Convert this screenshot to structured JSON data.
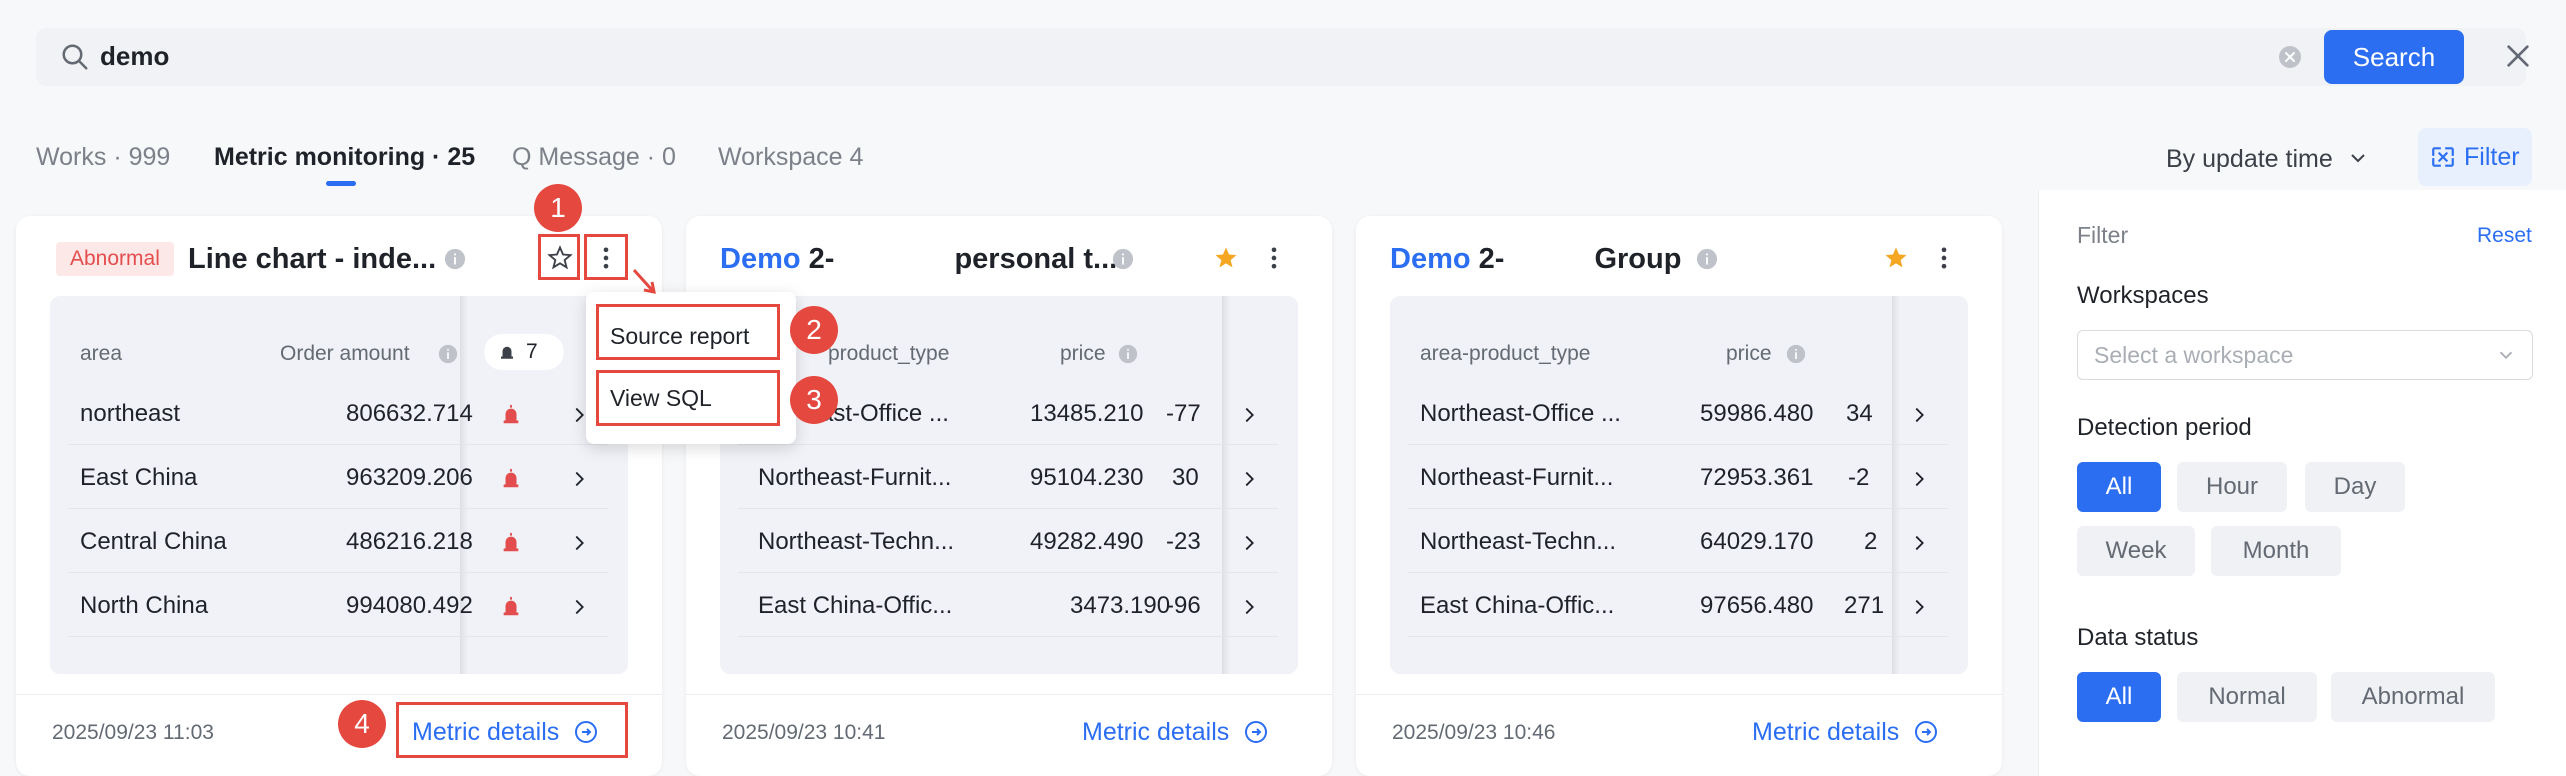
{
  "search": {
    "value": "demo",
    "button_label": "Search"
  },
  "tabs": [
    {
      "label": "Works · 999"
    },
    {
      "label": "Metric monitoring · 25"
    },
    {
      "label": "Q Message · 0"
    },
    {
      "label": "Workspace 4"
    }
  ],
  "sort_label": "By update time",
  "filter_button_label": "Filter",
  "cards": [
    {
      "badge": "Abnormal",
      "title": "Line chart - inde...",
      "headers": [
        "area",
        "Order amount",
        "7"
      ],
      "rows": [
        {
          "name": "northeast",
          "value": "806632.714"
        },
        {
          "name": "East China",
          "value": "963209.206"
        },
        {
          "name": "Central China",
          "value": "486216.218"
        },
        {
          "name": "North China",
          "value": "994080.492"
        }
      ],
      "date": "2025/09/23 11:03",
      "details_label": "Metric details"
    },
    {
      "title_prefix": "Demo",
      "title_a": "2-",
      "title_b": "personal t...",
      "headers": [
        "product_type",
        "price"
      ],
      "rows": [
        {
          "name": "ast-Office ...",
          "value": "13485.210",
          "extra": "-77"
        },
        {
          "name": "Northeast-Furnit...",
          "value": "95104.230",
          "extra": "30"
        },
        {
          "name": "Northeast-Techn...",
          "value": "49282.490",
          "extra": "-23"
        },
        {
          "name": "East China-Offic...",
          "value": "3473.190",
          "extra": "-96"
        }
      ],
      "date": "2025/09/23 10:41",
      "details_label": "Metric details"
    },
    {
      "title_prefix": "Demo",
      "title_a": "2-",
      "title_b": "Group",
      "headers": [
        "area-product_type",
        "price"
      ],
      "rows": [
        {
          "name": "Northeast-Office ...",
          "value": "59986.480",
          "extra": "34"
        },
        {
          "name": "Northeast-Furnit...",
          "value": "72953.361",
          "extra": "-2"
        },
        {
          "name": "Northeast-Techn...",
          "value": "64029.170",
          "extra": "2"
        },
        {
          "name": "East China-Offic...",
          "value": "97656.480",
          "extra": "271"
        }
      ],
      "date": "2025/09/23 10:46",
      "details_label": "Metric details"
    }
  ],
  "popup": {
    "items": [
      "Source report",
      "View SQL"
    ]
  },
  "annotations": [
    "1",
    "2",
    "3",
    "4"
  ],
  "filter_panel": {
    "title": "Filter",
    "reset": "Reset",
    "workspaces_label": "Workspaces",
    "workspace_placeholder": "Select a workspace",
    "detection_label": "Detection period",
    "detection_options": [
      "All",
      "Hour",
      "Day",
      "Week",
      "Month"
    ],
    "status_label": "Data status",
    "status_options": [
      "All",
      "Normal",
      "Abnormal"
    ]
  },
  "colors": {
    "accent": "#2b6ef2",
    "annotation": "#e5483f",
    "star": "#f5a623",
    "alarm": "#e34d4d"
  }
}
